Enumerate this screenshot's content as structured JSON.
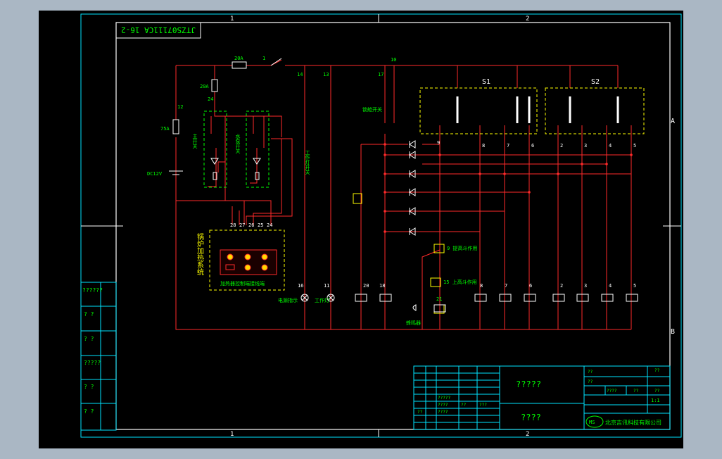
{
  "drawing": {
    "title_block_rotated": "JTZS07111CA 16-2",
    "zone_cols": [
      "1",
      "2"
    ],
    "zone_rows": [
      "A",
      "B"
    ],
    "left_strip_labels": [
      "??????",
      "? ?",
      "? ?",
      "?????",
      "? ?",
      "? ?"
    ],
    "panel_labels": [
      "S1",
      "S2"
    ],
    "fuse_labels": [
      "20A",
      "20A",
      "75A"
    ],
    "power_label": "DC12V",
    "wire_numbers_top": [
      "1",
      "10",
      "12",
      "24",
      "13",
      "17",
      "14"
    ],
    "switch_labels": [
      "主开关",
      "水泵开关",
      "工作灯开关",
      "锁舱开关"
    ],
    "heating_system_label": "锅炉加热系统",
    "heating_terminals": [
      "28",
      "27",
      "26",
      "25",
      "24"
    ],
    "heating_box_caption": "加热器控制端接线端",
    "load_numbers": [
      "16",
      "11",
      "20",
      "18",
      "8",
      "7",
      "6",
      "2",
      "3",
      "4",
      "5"
    ],
    "load_labels": [
      "电源指示",
      "工作灯",
      "蜂鸣器"
    ],
    "relay_labels": [
      "9 提高斗作用",
      "15 上高斗作用",
      "21"
    ],
    "s1_numbers": [
      "9",
      "8",
      "7",
      "6"
    ],
    "s2_numbers": [
      "2",
      "3",
      "4",
      "5"
    ],
    "title_table": {
      "main_title": "?????",
      "sub_title": "????",
      "company": "北京吉讯科技有限公司",
      "logo_text": "MS",
      "scale": "1:1",
      "cells": [
        "??",
        "??",
        "??",
        "????",
        "??",
        "??",
        "?????",
        "????",
        "??",
        "???",
        "??",
        "????"
      ]
    }
  }
}
